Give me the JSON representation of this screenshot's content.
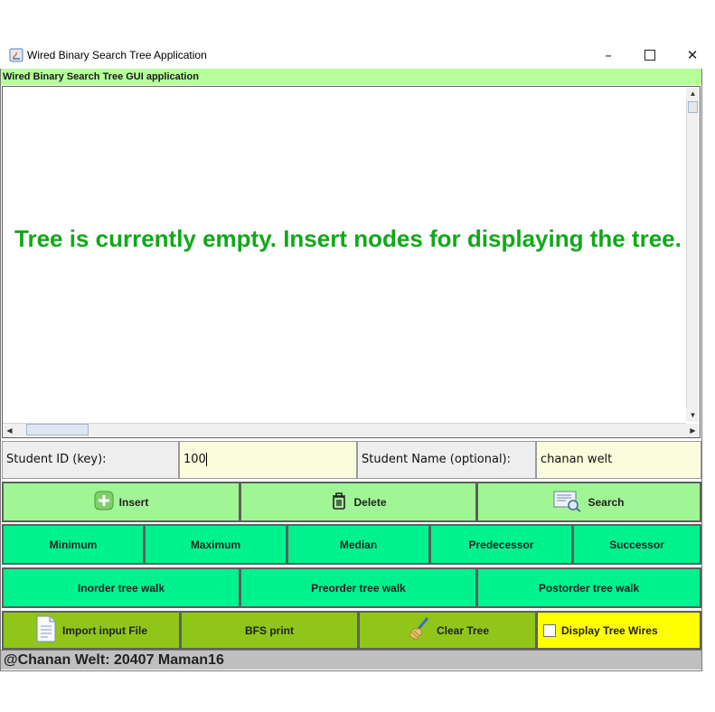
{
  "window": {
    "title": "Wired Binary Search Tree Application",
    "minimize_icon": "minimize-icon",
    "maximize_icon": "maximize-icon",
    "close_icon": "close-icon"
  },
  "header": {
    "label": "Wired Binary Search Tree GUI application"
  },
  "tree_view": {
    "empty_message": "Tree is currently empty. Insert nodes for displaying the tree."
  },
  "inputs": {
    "student_id_label": "Student ID (key):",
    "student_id_value": "100",
    "student_name_label": "Student Name (optional):",
    "student_name_value": "chanan welt"
  },
  "actions": {
    "insert": "Insert",
    "delete": "Delete",
    "search": "Search"
  },
  "queries": {
    "minimum": "Minimum",
    "maximum": "Maximum",
    "median": "Median",
    "predecessor": "Predecessor",
    "successor": "Successor"
  },
  "walks": {
    "inorder": "Inorder tree walk",
    "preorder": "Preorder tree walk",
    "postorder": "Postorder tree walk"
  },
  "tools": {
    "import_file": "Import input File",
    "bfs_print": "BFS print",
    "clear_tree": "Clear Tree",
    "display_wires": "Display Tree Wires",
    "display_wires_checked": false
  },
  "footer": {
    "text": "@Chanan Welt: 20407 Maman16"
  },
  "colors": {
    "header_bg": "#b6ff9a",
    "message": "#11a81a",
    "action_bg": "#a0f595",
    "query_bg": "#00f28e",
    "tool_bg": "#8fc619",
    "wires_bg": "#ffff00",
    "input_bg": "#fbfbdd"
  }
}
